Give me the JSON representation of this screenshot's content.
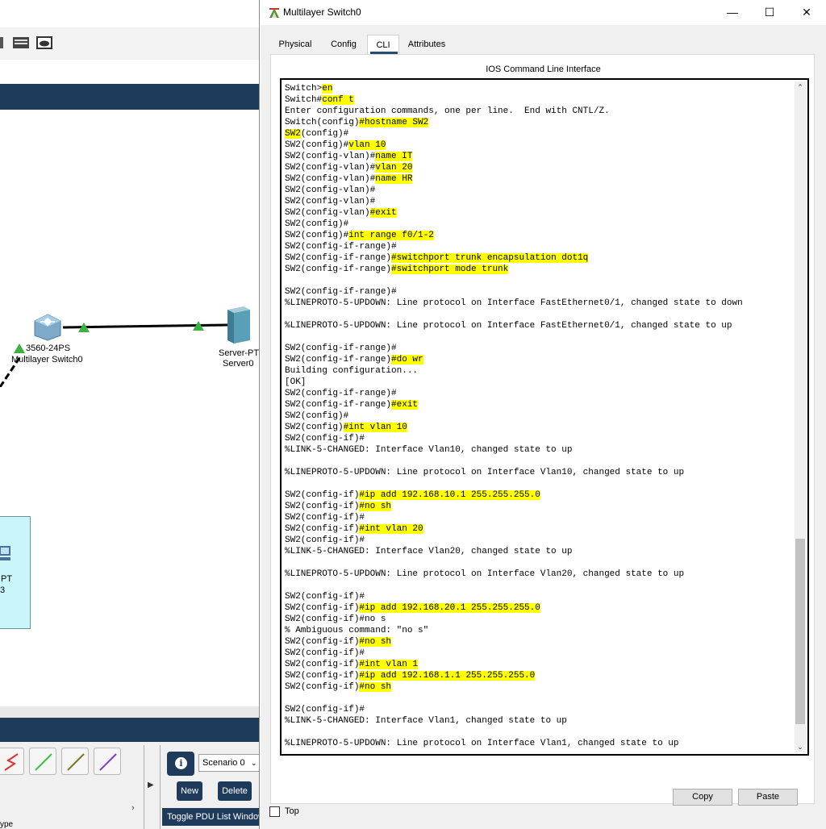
{
  "window": {
    "title": "Multilayer Switch0"
  },
  "tabs": [
    {
      "label": "Physical"
    },
    {
      "label": "Config"
    },
    {
      "label": "CLI"
    },
    {
      "label": "Attributes"
    }
  ],
  "active_tab": "CLI",
  "panel_title": "IOS Command Line Interface",
  "terminal_lines": [
    [
      {
        "t": "Switch>"
      },
      {
        "t": "en",
        "hl": true
      }
    ],
    [
      {
        "t": "Switch#"
      },
      {
        "t": "conf t",
        "hl": true
      }
    ],
    [
      {
        "t": "Enter configuration commands, one per line.  End with CNTL/Z."
      }
    ],
    [
      {
        "t": "Switch(config)"
      },
      {
        "t": "#hostname SW2",
        "hl": true
      }
    ],
    [
      {
        "t": "SW2",
        "hl": true
      },
      {
        "t": "(config)#"
      }
    ],
    [
      {
        "t": "SW2(config)#"
      },
      {
        "t": "vlan 10",
        "hl": true
      }
    ],
    [
      {
        "t": "SW2(config-vlan)#"
      },
      {
        "t": "name IT",
        "hl": true
      }
    ],
    [
      {
        "t": "SW2(config-vlan)#"
      },
      {
        "t": "vlan 20",
        "hl": true
      }
    ],
    [
      {
        "t": "SW2(config-vlan)#"
      },
      {
        "t": "name HR",
        "hl": true
      }
    ],
    [
      {
        "t": "SW2(config-vlan)#"
      }
    ],
    [
      {
        "t": "SW2(config-vlan)#"
      }
    ],
    [
      {
        "t": "SW2(config-vlan)"
      },
      {
        "t": "#exit",
        "hl": true
      }
    ],
    [
      {
        "t": "SW2(config)#"
      }
    ],
    [
      {
        "t": "SW2(config)#"
      },
      {
        "t": "int range f0/1-2",
        "hl": true
      }
    ],
    [
      {
        "t": "SW2(config-if-range)#"
      }
    ],
    [
      {
        "t": "SW2(config-if-range)"
      },
      {
        "t": "#switchport trunk encapsulation dot1q",
        "hl": true
      }
    ],
    [
      {
        "t": "SW2(config-if-range)"
      },
      {
        "t": "#switchport mode trunk",
        "hl": true
      }
    ],
    [],
    [
      {
        "t": "SW2(config-if-range)#"
      }
    ],
    [
      {
        "t": "%LINEPROTO-5-UPDOWN: Line protocol on Interface FastEthernet0/1, changed state to down"
      }
    ],
    [],
    [
      {
        "t": "%LINEPROTO-5-UPDOWN: Line protocol on Interface FastEthernet0/1, changed state to up"
      }
    ],
    [],
    [
      {
        "t": "SW2(config-if-range)#"
      }
    ],
    [
      {
        "t": "SW2(config-if-range)"
      },
      {
        "t": "#do wr",
        "hl": true
      }
    ],
    [
      {
        "t": "Building configuration..."
      }
    ],
    [
      {
        "t": "[OK]"
      }
    ],
    [
      {
        "t": "SW2(config-if-range)#"
      }
    ],
    [
      {
        "t": "SW2(config-if-range)"
      },
      {
        "t": "#exit",
        "hl": true
      }
    ],
    [
      {
        "t": "SW2(config)#"
      }
    ],
    [
      {
        "t": "SW2(config)"
      },
      {
        "t": "#int vlan 10",
        "hl": true
      }
    ],
    [
      {
        "t": "SW2(config-if)#"
      }
    ],
    [
      {
        "t": "%LINK-5-CHANGED: Interface Vlan10, changed state to up"
      }
    ],
    [],
    [
      {
        "t": "%LINEPROTO-5-UPDOWN: Line protocol on Interface Vlan10, changed state to up"
      }
    ],
    [],
    [
      {
        "t": "SW2(config-if)"
      },
      {
        "t": "#ip add 192.168.10.1 255.255.255.0",
        "hl": true
      }
    ],
    [
      {
        "t": "SW2(config-if)"
      },
      {
        "t": "#no sh",
        "hl": true
      }
    ],
    [
      {
        "t": "SW2(config-if)#"
      }
    ],
    [
      {
        "t": "SW2(config-if)"
      },
      {
        "t": "#int vlan 20",
        "hl": true
      }
    ],
    [
      {
        "t": "SW2(config-if)#"
      }
    ],
    [
      {
        "t": "%LINK-5-CHANGED: Interface Vlan20, changed state to up"
      }
    ],
    [],
    [
      {
        "t": "%LINEPROTO-5-UPDOWN: Line protocol on Interface Vlan20, changed state to up"
      }
    ],
    [],
    [
      {
        "t": "SW2(config-if)#"
      }
    ],
    [
      {
        "t": "SW2(config-if)"
      },
      {
        "t": "#ip add 192.168.20.1 255.255.255.0",
        "hl": true
      }
    ],
    [
      {
        "t": "SW2(config-if)#no s"
      }
    ],
    [
      {
        "t": "% Ambiguous command: \"no s\""
      }
    ],
    [
      {
        "t": "SW2(config-if)"
      },
      {
        "t": "#no sh",
        "hl": true
      }
    ],
    [
      {
        "t": "SW2(config-if)#"
      }
    ],
    [
      {
        "t": "SW2(config-if)"
      },
      {
        "t": "#int vlan 1",
        "hl": true
      }
    ],
    [
      {
        "t": "SW2(config-if)"
      },
      {
        "t": "#ip add 192.168.1.1 255.255.255.0",
        "hl": true
      }
    ],
    [
      {
        "t": "SW2(config-if)"
      },
      {
        "t": "#no sh",
        "hl": true
      }
    ],
    [],
    [
      {
        "t": "SW2(config-if)#"
      }
    ],
    [
      {
        "t": "%LINK-5-CHANGED: Interface Vlan1, changed state to up"
      }
    ],
    [],
    [
      {
        "t": "%LINEPROTO-5-UPDOWN: Line protocol on Interface Vlan1, changed state to up"
      }
    ]
  ],
  "buttons": {
    "copy": "Copy",
    "paste": "Paste"
  },
  "top_checkbox": {
    "label": "Top",
    "checked": false
  },
  "workspace": {
    "switch_model": "3560-24PS",
    "switch_name": "Multilayer Switch0",
    "server_model": "Server-PT",
    "server_name": "Server0",
    "pc_model": "PT",
    "pc_name": "3",
    "scenario": "Scenario 0",
    "new_label": "New",
    "delete_label": "Delete",
    "toggle_pdu_label": "Toggle PDU List Window",
    "type_label": "ype"
  },
  "colors": {
    "highlight": "#ffff00",
    "navy": "#1f3b5c",
    "link_green": "#3cb043"
  },
  "icons": {
    "window": "packet-tracer-icon",
    "minimize": "minimize-icon",
    "maximize": "maximize-icon",
    "close": "close-icon"
  }
}
